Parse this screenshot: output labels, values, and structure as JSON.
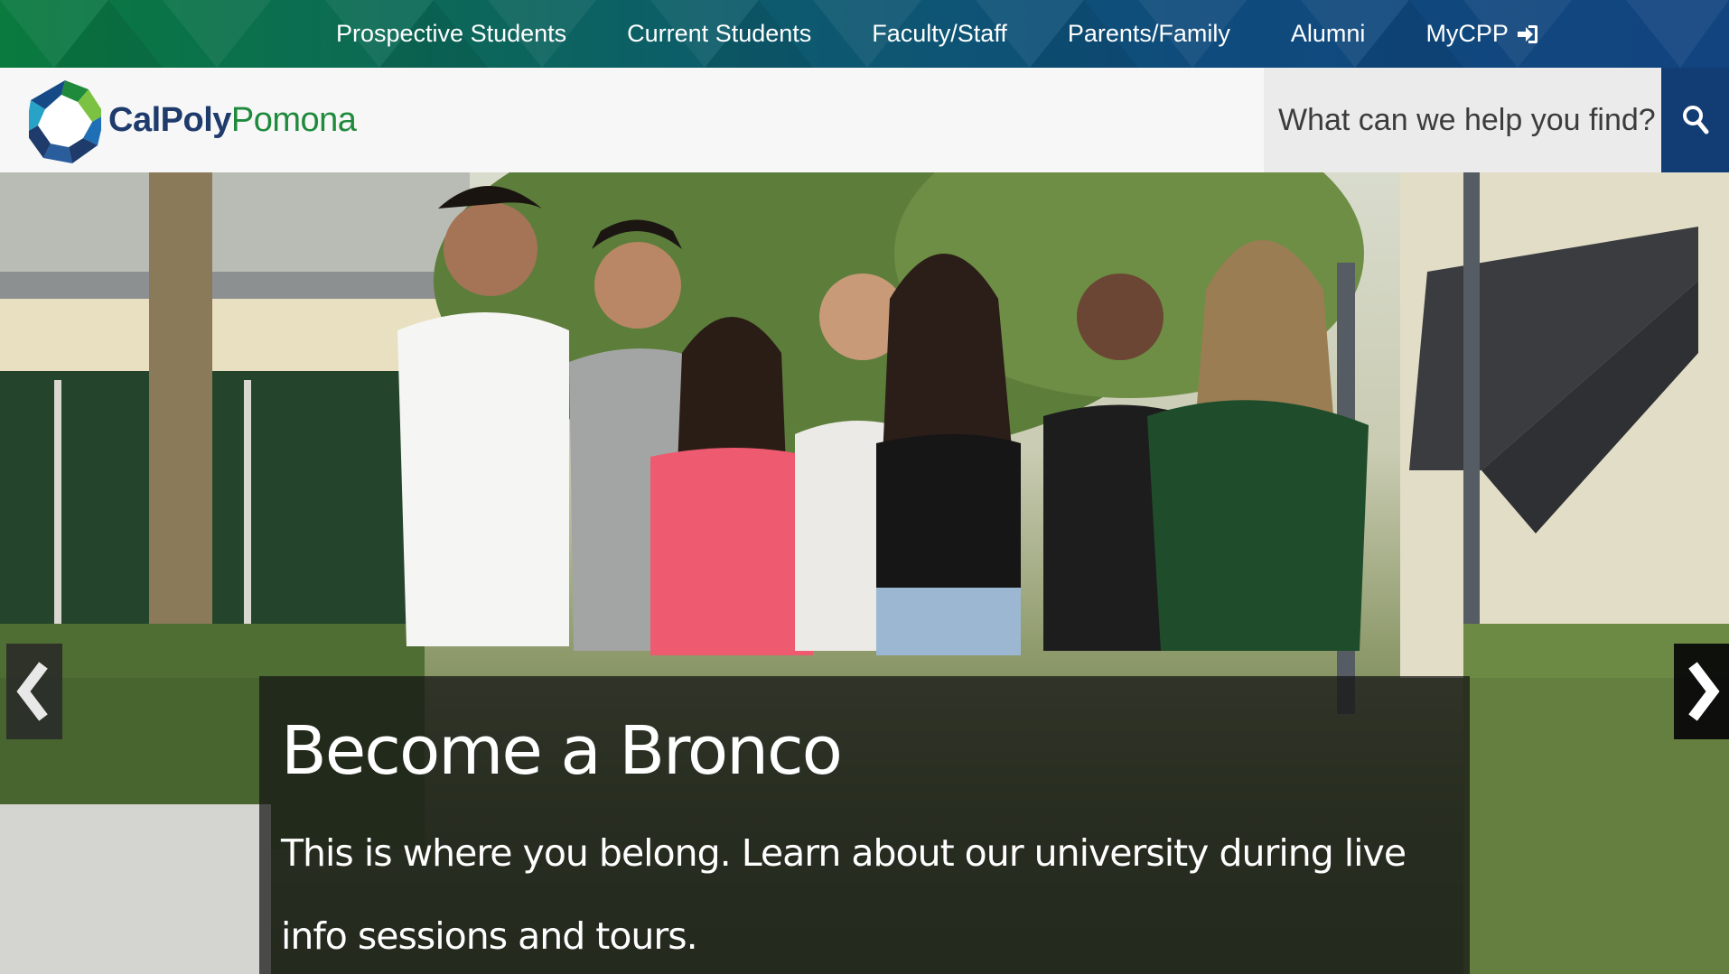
{
  "topnav": {
    "items": [
      {
        "label": "Prospective Students"
      },
      {
        "label": "Current Students"
      },
      {
        "label": "Faculty/Staff"
      },
      {
        "label": "Parents/Family"
      },
      {
        "label": "Alumni"
      },
      {
        "label": "MyCPP",
        "icon": "sign-in-icon"
      }
    ]
  },
  "header": {
    "logo": {
      "part1": "CalPoly",
      "part2": "Pomona"
    },
    "search": {
      "placeholder": "What can we help you find?",
      "icon": "search-icon"
    }
  },
  "hero": {
    "title": "Become a Bronco",
    "text": "This is where you belong. Learn about our university during live info sessions and tours.",
    "prev_icon": "chevron-left-icon",
    "next_icon": "chevron-right-icon"
  },
  "colors": {
    "brand_green": "#1f8a3c",
    "brand_blue": "#1e3b6c",
    "search_button": "#123d74"
  }
}
